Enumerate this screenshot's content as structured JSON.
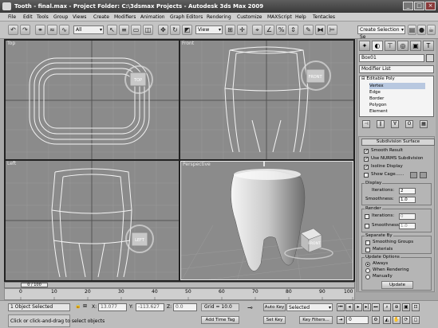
{
  "window": {
    "title": "Tooth - final.max     - Project Folder: C:\\3dsmax Projects     - Autodesk 3ds Max  2009",
    "minimize": "_",
    "maximize": "□",
    "close": "×"
  },
  "menu": [
    "File",
    "Edit",
    "Tools",
    "Group",
    "Views",
    "Create",
    "Modifiers",
    "Animation",
    "Graph Editors",
    "Rendering",
    "Customize",
    "MAXScript",
    "Help",
    "Tentacles"
  ],
  "toolbar": {
    "selection_filter": "All",
    "reference_coord": "View",
    "named_selection": "Create Selection Se",
    "icons": [
      "undo-icon",
      "redo-icon",
      "link-icon",
      "unlink-icon",
      "bind-spacewarp-icon",
      "select-icon",
      "select-by-name-icon",
      "rect-region-icon",
      "window-crossing-icon",
      "move-icon",
      "rotate-icon",
      "scale-icon",
      "pivot-icon",
      "manipulate-icon",
      "snap-icon",
      "angle-snap-icon",
      "percent-snap-icon",
      "spinner-snap-icon",
      "edit-named-sel-icon",
      "mirror-icon",
      "align-icon",
      "layer-icon",
      "curve-editor-icon",
      "schematic-icon",
      "material-editor-icon",
      "render-setup-icon",
      "render-frame-icon",
      "quick-render-icon"
    ]
  },
  "viewports": {
    "top": {
      "label": "Top",
      "cube": "TOP"
    },
    "front": {
      "label": "Front",
      "cube": "FRONT"
    },
    "left": {
      "label": "Left",
      "cube": "LEFT"
    },
    "perspective": {
      "label": "Perspective",
      "cube": "FRONT"
    }
  },
  "command_panel": {
    "tabs": [
      "create-tab-icon",
      "modify-tab-icon",
      "hierarchy-tab-icon",
      "motion-tab-icon",
      "display-tab-icon",
      "utilities-tab-icon"
    ],
    "object_name": "Box01",
    "modifier_list": "Modifier List",
    "stack": {
      "root": "Editable Poly",
      "items": [
        "Vertex",
        "Edge",
        "Border",
        "Polygon",
        "Element"
      ]
    },
    "stack_buttons": [
      "pin-stack-icon",
      "show-end-result-icon",
      "make-unique-icon",
      "remove-modifier-icon",
      "configure-sets-icon"
    ],
    "subdivision": {
      "title": "Subdivision Surface",
      "smooth_result": "Smooth Result",
      "use_nurms": "Use NURMS Subdivision",
      "isoline": "Isoline Display",
      "show_cage": "Show Cage......",
      "display_group": "Display",
      "iterations_label": "Iterations:",
      "iterations_value": "2",
      "smoothness_label": "Smoothness:",
      "smoothness_value": "1.0",
      "render_group": "Render",
      "r_iterations_label": "Iterations:",
      "r_iterations_value": "0",
      "r_smoothness_label": "Smoothness:",
      "r_smoothness_value": "1.0",
      "separate_group": "Separate By",
      "smoothing_groups": "Smoothing Groups",
      "materials": "Materials",
      "update_group": "Update Options",
      "always": "Always",
      "when_rendering": "When Rendering",
      "manually": "Manually",
      "update": "Update"
    }
  },
  "timeline": {
    "frame_readout": "0 / 100",
    "ticks": [
      "0",
      "10",
      "20",
      "30",
      "40",
      "50",
      "60",
      "70",
      "80",
      "90",
      "100"
    ]
  },
  "status": {
    "selected": "1 Object Selected",
    "prompt": "Click or click-and-drag to select objects",
    "x_label": "X:",
    "x_value": "13.077",
    "y_label": "Y:",
    "y_value": "-113.627",
    "z_label": "Z:",
    "z_value": "0.0",
    "grid": "Grid = 10.0",
    "add_time_tag": "Add Time Tag",
    "auto_key": "Auto Key",
    "set_key": "Set Key",
    "key_mode": "Selected",
    "key_filters": "Key Filters...",
    "frame": "0"
  },
  "colors": {
    "viewport_bg": "#8b8b8b",
    "titlebar": "#4a4a4a",
    "wireframe": "#f4f4f4"
  }
}
